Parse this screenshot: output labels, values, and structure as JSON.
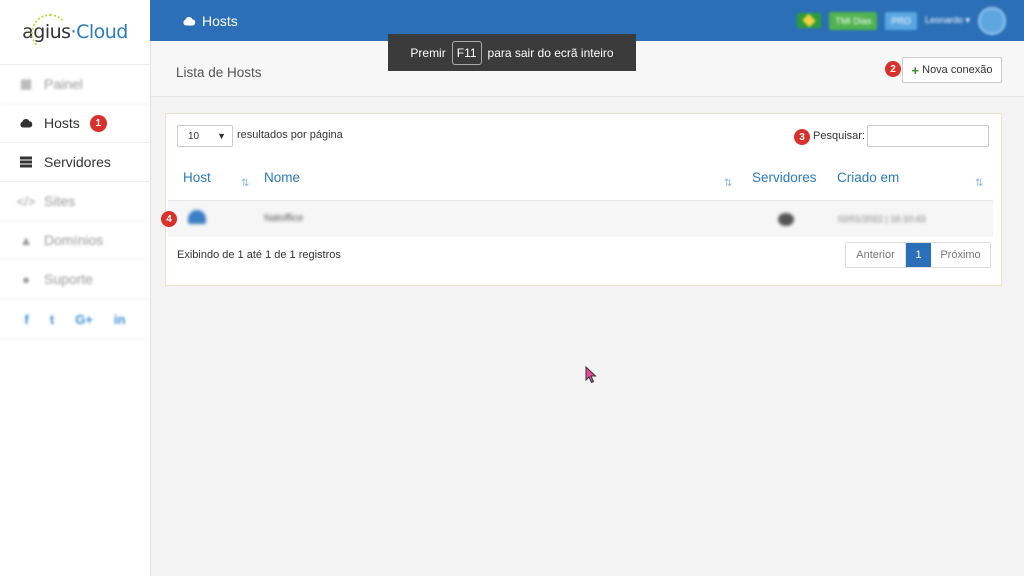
{
  "sidebar": {
    "logo_text": "agius",
    "logo_text2": "Cloud",
    "items": [
      {
        "label": "Painel",
        "icon": "dashboard-icon"
      },
      {
        "label": "Hosts",
        "icon": "cloud-icon",
        "badge": "1"
      },
      {
        "label": "Servidores",
        "icon": "server-icon"
      },
      {
        "label": "Sites",
        "icon": "code-icon"
      },
      {
        "label": "Domínios",
        "icon": "car-icon"
      },
      {
        "label": "Suporte",
        "icon": "chat-icon"
      }
    ],
    "social": [
      "f",
      "t",
      "G+",
      "in"
    ]
  },
  "topbar": {
    "title": "Hosts",
    "trial": "TMI Dias",
    "pro": "PRO",
    "user": "Leonardo ▾"
  },
  "fullscreen_notice": {
    "before": "Premir",
    "key": "F11",
    "after": "para sair do ecrã inteiro"
  },
  "page": {
    "title": "Lista de Hosts",
    "new_button": "Nova conexão",
    "badges": [
      "2",
      "3",
      "4"
    ]
  },
  "table": {
    "page_size": "10",
    "per_page_label": "resultados por página",
    "search_label": "Pesquisar:",
    "columns": [
      "Host",
      "Nome",
      "Servidores",
      "Criado em"
    ],
    "rows": [
      {
        "name": "Natoffice",
        "servers": "0",
        "created": "02/01/2022 | 16:10:43"
      }
    ],
    "info": "Exibindo de 1 até 1 de 1 registros",
    "prev": "Anterior",
    "current_page": "1",
    "next": "Próximo"
  },
  "colors": {
    "topbar": "#2a6fb7",
    "accent": "#2a7bbd",
    "badge": "#d9302c"
  }
}
